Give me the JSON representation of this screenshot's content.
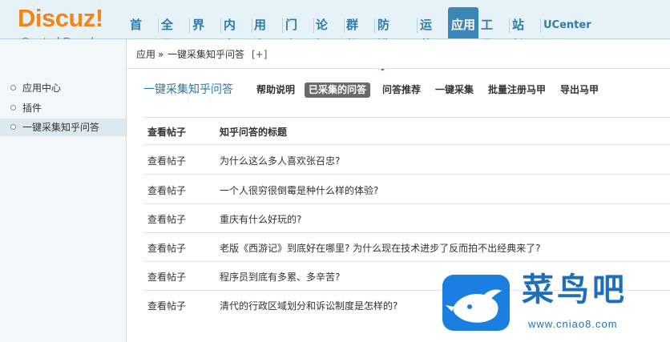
{
  "logo": {
    "main": "Discuz!",
    "sub": "Control Panel"
  },
  "nav": {
    "items": [
      "首页",
      "全局",
      "界面",
      "内容",
      "用户",
      "门户",
      "论坛",
      "群组",
      "防灌水",
      "运营",
      "应用",
      "工具",
      "站长",
      "UCenter"
    ],
    "active": "应用"
  },
  "sidebar": {
    "items": [
      {
        "label": "应用中心"
      },
      {
        "label": "插件"
      },
      {
        "label": "一键采集知乎问答"
      }
    ],
    "active": "一键采集知乎问答"
  },
  "breadcrumb": {
    "root": "应用",
    "sep": "»",
    "current": "一键采集知乎问答",
    "add": "[+]"
  },
  "page": {
    "title": "一键采集知乎问答",
    "tabs": [
      "帮助说明",
      "已采集的问答",
      "问答推荐",
      "一键采集",
      "批量注册马甲",
      "导出马甲"
    ],
    "active_tab": "已采集的问答"
  },
  "table": {
    "headers": [
      "查看帖子",
      "知乎问答的标题"
    ],
    "rows": [
      {
        "action": "查看帖子",
        "title": "为什么这么多人喜欢张召忠?"
      },
      {
        "action": "查看帖子",
        "title": "一个人很穷很倒霉是种什么样的体验?"
      },
      {
        "action": "查看帖子",
        "title": "重庆有什么好玩的?"
      },
      {
        "action": "查看帖子",
        "title": "老版《西游记》到底好在哪里? 为什么现在技术进步了反而拍不出经典来了?"
      },
      {
        "action": "查看帖子",
        "title": "程序员到底有多累、多辛苦?"
      },
      {
        "action": "查看帖子",
        "title": "清代的行政区域划分和诉讼制度是怎样的?"
      }
    ]
  },
  "watermark": {
    "text": "菜鸟吧",
    "url": "www.cniao8.com"
  },
  "colors": {
    "header_bg": "#e6f2f8",
    "nav_text": "#2b7bab",
    "nav_active_bg": "#3a87b7",
    "logo": "#f0851a",
    "watermark": "#1a7fe0"
  }
}
